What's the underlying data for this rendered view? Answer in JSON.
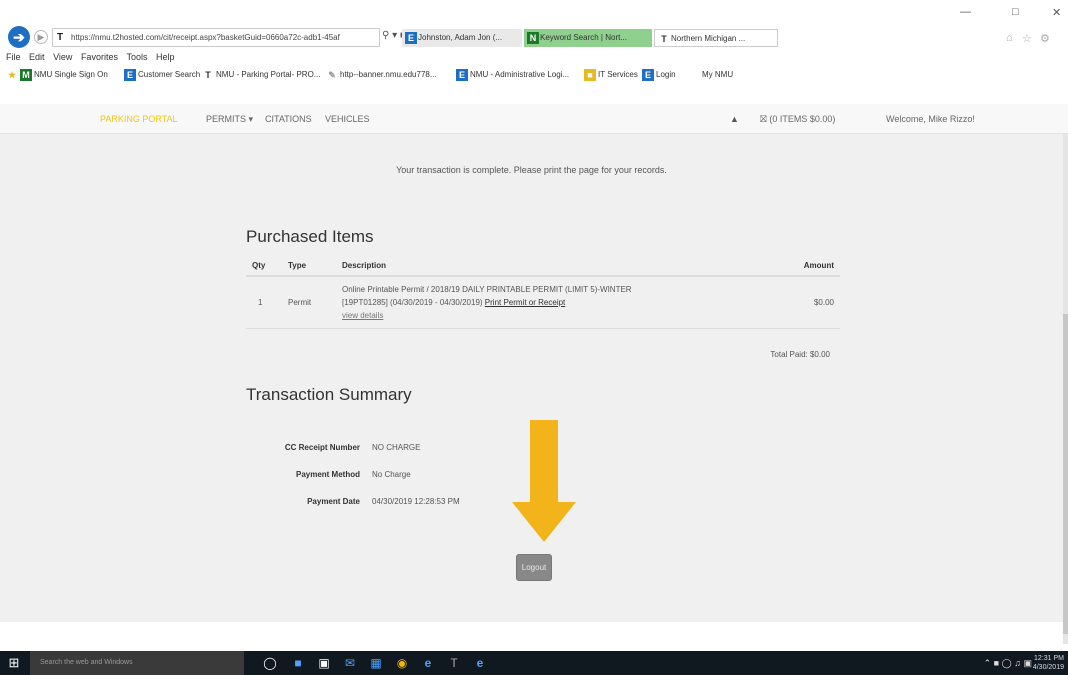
{
  "browser": {
    "url": "https://nmu.t2hosted.com/cit/receipt.aspx?basketGuid=0660a72c-adb1-45af",
    "tabs": [
      {
        "label": "Johnston, Adam Jon (..."
      },
      {
        "label": "Keyword Search | Nort..."
      },
      {
        "label": "Northern Michigan ..."
      }
    ],
    "menu": [
      "File",
      "Edit",
      "View",
      "Favorites",
      "Tools",
      "Help"
    ],
    "favorites": [
      {
        "label": "NMU Single Sign On"
      },
      {
        "label": "Customer Search"
      },
      {
        "label": "NMU - Parking Portal- PRO..."
      },
      {
        "label": "http--banner.nmu.edu778..."
      },
      {
        "label": "NMU - Administrative Logi..."
      },
      {
        "label": "IT Services"
      },
      {
        "label": "Login"
      },
      {
        "label": "My NMU"
      }
    ]
  },
  "nav": {
    "brand": "PARKING PORTAL",
    "permits": "PERMITS",
    "citations": "CITATIONS",
    "vehicles": "VEHICLES",
    "cart": "(0 ITEMS $0.00)",
    "welcome": "Welcome, Mike Rizzo!"
  },
  "page": {
    "message": "Your transaction is complete. Please print the page for your records.",
    "purchased_heading": "Purchased Items",
    "columns": {
      "qty": "Qty",
      "type": "Type",
      "description": "Description",
      "amount": "Amount"
    },
    "items": [
      {
        "qty": "1",
        "type": "Permit",
        "desc1": "Online Printable Permit / 2018/19 DAILY PRINTABLE PERMIT (LIMIT 5)-WINTER",
        "desc2": "[19PT01285] (04/30/2019 - 04/30/2019)",
        "print_link": "Print Permit or Receipt",
        "details_link": "view details",
        "amount": "$0.00"
      }
    ],
    "total": "Total Paid: $0.00",
    "summary_heading": "Transaction Summary",
    "summary": [
      {
        "label": "CC Receipt Number",
        "value": "NO CHARGE"
      },
      {
        "label": "Payment Method",
        "value": "No Charge"
      },
      {
        "label": "Payment Date",
        "value": "04/30/2019 12:28:53 PM"
      }
    ],
    "logout": "Logout"
  },
  "taskbar": {
    "search_placeholder": "Search the web and Windows",
    "clock_time": "12:31 PM",
    "clock_date": "4/30/2019"
  },
  "colors": {
    "arrow": "#f3b31b",
    "nav_brand": "#f0c419",
    "taskbar": "#101820"
  }
}
